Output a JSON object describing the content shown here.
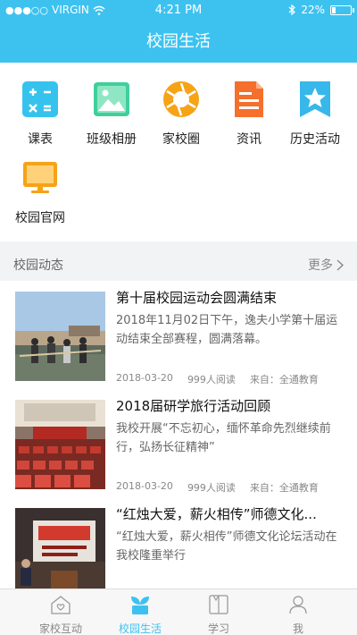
{
  "status": {
    "carrier": "VIRGIN",
    "time": "4:21 PM",
    "battery": "22%",
    "battery_level": 0.22
  },
  "header": {
    "title": "校园生活"
  },
  "apps": [
    {
      "label": "课表",
      "icon": "calculator-icon"
    },
    {
      "label": "班级相册",
      "icon": "photo-album-icon"
    },
    {
      "label": "家校圈",
      "icon": "aperture-icon"
    },
    {
      "label": "资讯",
      "icon": "news-document-icon"
    },
    {
      "label": "历史活动",
      "icon": "star-bookmark-icon"
    },
    {
      "label": "校园官网",
      "icon": "monitor-icon"
    }
  ],
  "section": {
    "title": "校园动态",
    "more": "更多"
  },
  "news": [
    {
      "title": "第十届校园运动会圆满结束",
      "desc": "2018年11月02日下午，逸夫小学第十届运动结束全部赛程，圆满落幕。",
      "date": "2018-03-20",
      "reads": "999人阅读",
      "source": "来自：全通教育"
    },
    {
      "title": "2018届研学旅行活动回顾",
      "desc": "我校开展“不忘初心，缅怀革命先烈继续前行，弘扬长征精神”",
      "date": "2018-03-20",
      "reads": "999人阅读",
      "source": "来自：全通教育"
    },
    {
      "title": "“红烛大爱，薪火相传”师德文化...",
      "desc": "“红烛大爱，薪火相传”师德文化论坛活动在我校隆重举行",
      "date": "",
      "reads": "",
      "source": ""
    }
  ],
  "tabs": [
    {
      "label": "家校互动",
      "icon": "home-heart-icon",
      "active": false
    },
    {
      "label": "校园生活",
      "icon": "sprout-icon",
      "active": true
    },
    {
      "label": "学习",
      "icon": "book-icon",
      "active": false
    },
    {
      "label": "我",
      "icon": "person-icon",
      "active": false
    }
  ],
  "colors": {
    "accent": "#3dc2f0",
    "tab_inactive": "#888888"
  }
}
